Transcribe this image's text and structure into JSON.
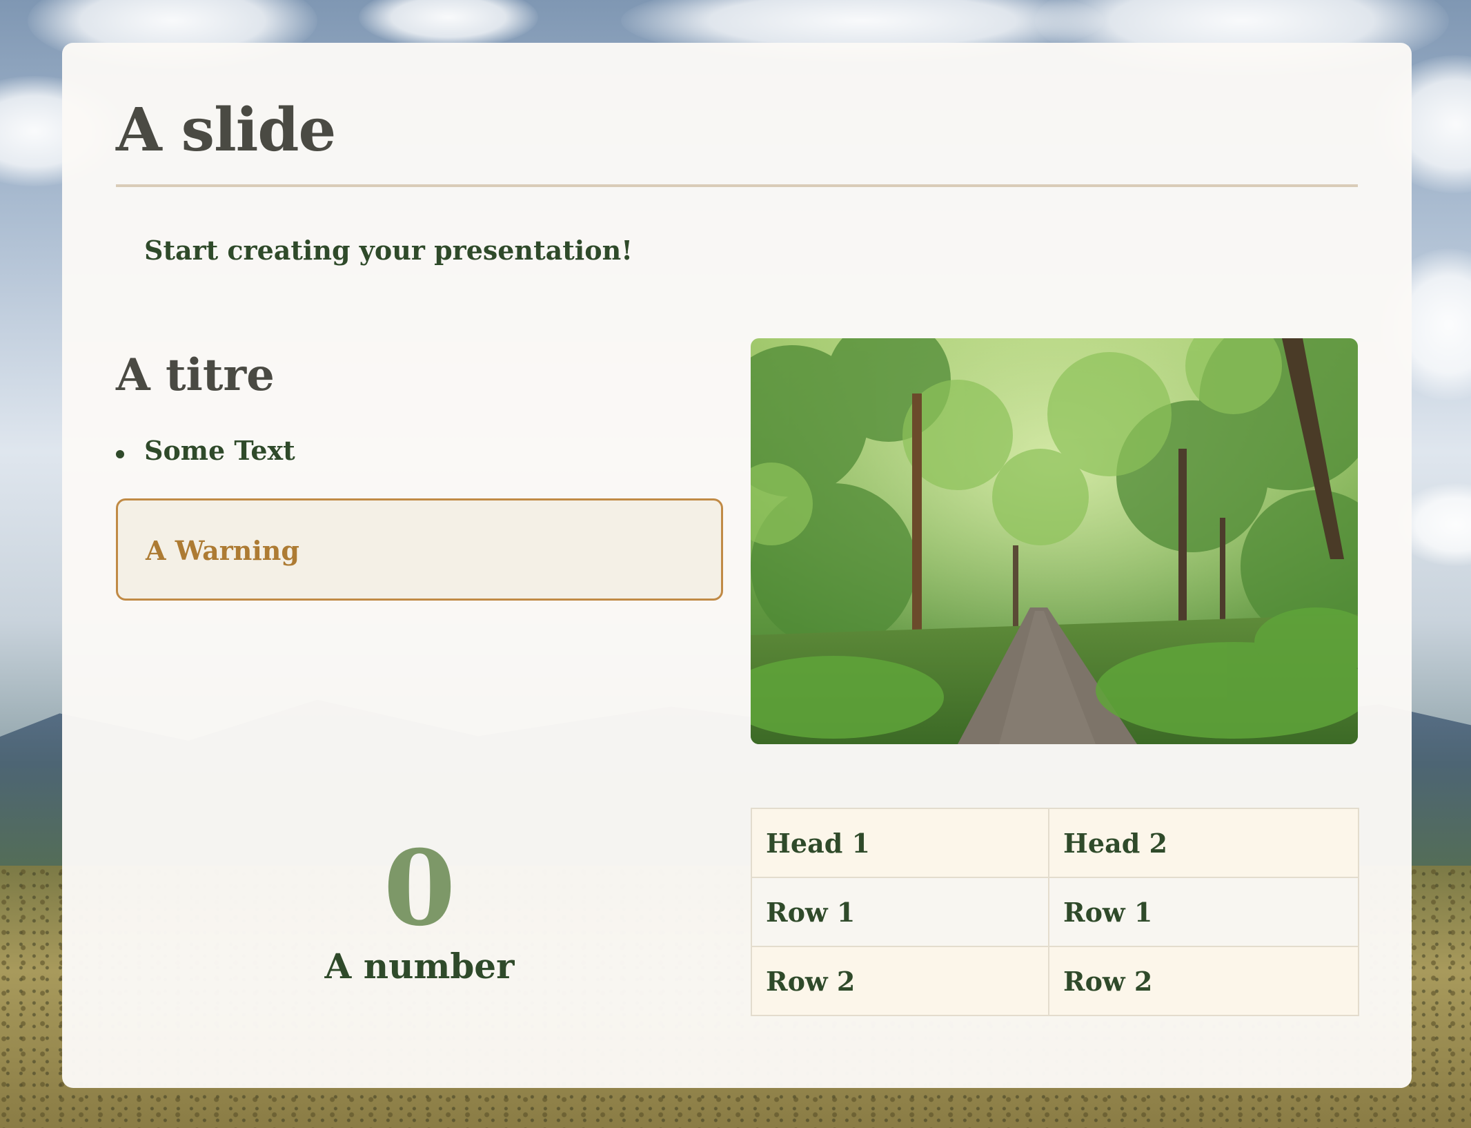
{
  "slide": {
    "title": "A slide",
    "intro": "Start creating your presentation!",
    "section_title": "A titre",
    "bullets": [
      "Some Text"
    ],
    "warning": "A Warning",
    "stat": {
      "value": "0",
      "label": "A number"
    },
    "image_icon": "forest-path-photo",
    "table": {
      "headers": [
        "Head 1",
        "Head 2"
      ],
      "rows": [
        [
          "Row 1",
          "Row 1"
        ],
        [
          "Row 2",
          "Row 2"
        ]
      ]
    }
  },
  "colors": {
    "heading": "#4a4a43",
    "text": "#2f4a2a",
    "accent_green": "#7d9868",
    "warning_border": "#c08a45",
    "warning_text": "#ad7b33",
    "rule": "#d9ccb8"
  }
}
